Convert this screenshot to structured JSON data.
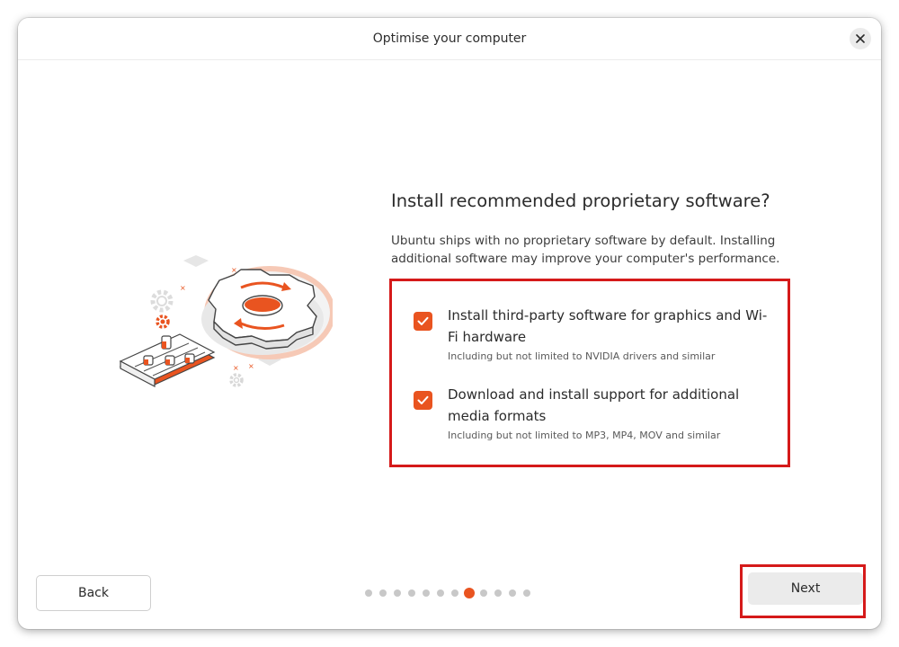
{
  "window": {
    "title": "Optimise your computer",
    "close_icon": "close-icon"
  },
  "main": {
    "heading": "Install recommended proprietary software?",
    "description": "Ubuntu ships with no proprietary software by default. Installing additional software may improve your computer's performance.",
    "options": [
      {
        "label": "Install third-party software for graphics and Wi-Fi hardware",
        "sublabel": "Including but not limited to NVIDIA drivers and similar",
        "checked": true
      },
      {
        "label": "Download and install support for additional media formats",
        "sublabel": "Including but not limited to MP3, MP4, MOV and similar",
        "checked": true
      }
    ]
  },
  "footer": {
    "back_label": "Back",
    "next_label": "Next",
    "steps_total": 12,
    "current_step": 8
  },
  "colors": {
    "accent": "#e95420",
    "highlight_border": "#d51a1a"
  }
}
